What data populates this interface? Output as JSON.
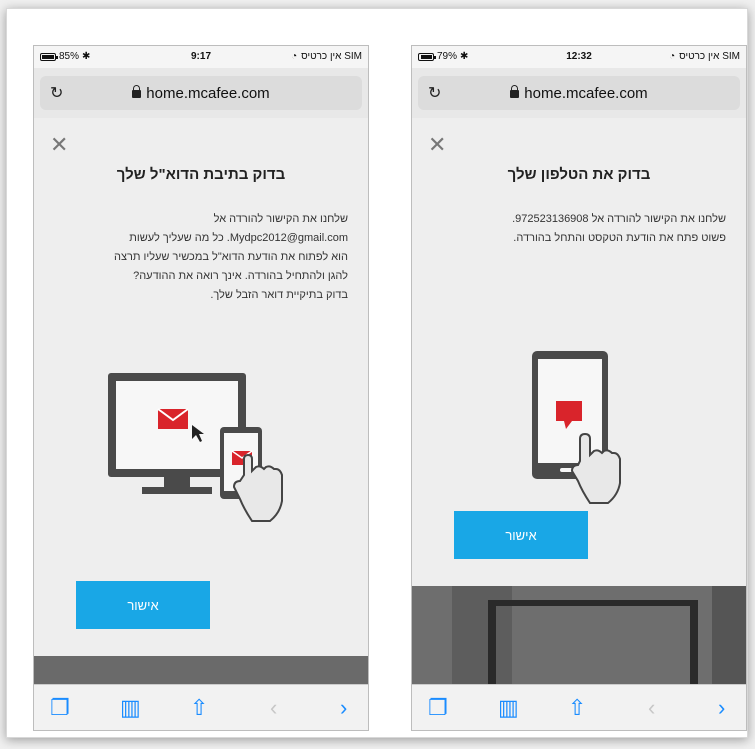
{
  "left_phone": {
    "status": {
      "carrier": "אין כרטיס SIM",
      "time": "9:17",
      "battery": "85%",
      "battery_fraction": 0.85
    },
    "url": "home.mcafee.com",
    "title": "בדוק בתיבת הדוא\"ל שלך",
    "body": "שלחנו את הקישור להורדה אל\nMydpc2012@gmail.com. כל מה שעליך לעשות\nהוא לפתוח את הודעת הדוא\"ל במכשיר שעליו תרצה\nלהגן ולהתחיל בהורדה. אינך רואה את ההודעה?\nבדוק בתיקיית דואר הזבל שלך.",
    "confirm_label": "אישור"
  },
  "right_phone": {
    "status": {
      "carrier": "אין כרטיס SIM",
      "time": "12:32",
      "battery": "79%",
      "battery_fraction": 0.79
    },
    "url": "home.mcafee.com",
    "title": "בדוק את הטלפון שלך",
    "body": "שלחנו את הקישור להורדה אל 972523136908.\nפשוט פתח את הודעת הטקסט והתחל בהורדה.",
    "confirm_label": "אישור"
  },
  "icons": {
    "reload": "reload-icon",
    "lock": "lock-icon",
    "close": "close-icon",
    "tabs": "tabs-icon",
    "bookmarks": "bookmarks-icon",
    "share": "share-icon",
    "back": "back-icon",
    "forward": "forward-icon"
  },
  "colors": {
    "accent": "#19a7e6",
    "mail_red": "#d9242b",
    "ios_blue": "#1a8cff"
  }
}
